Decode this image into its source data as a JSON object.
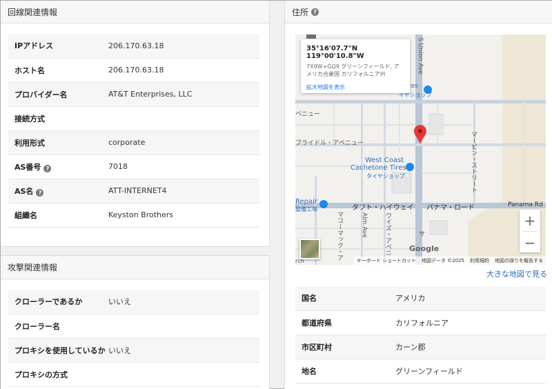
{
  "left_panel": {
    "title": "回線関連情報",
    "rows": [
      {
        "key": "IPアドレス",
        "value": "206.170.63.18",
        "help": false
      },
      {
        "key": "ホスト名",
        "value": "206.170.63.18",
        "help": false
      },
      {
        "key": "プロバイダー名",
        "value": "AT&T Enterprises, LLC",
        "help": false
      },
      {
        "key": "接続方式",
        "value": "",
        "help": false
      },
      {
        "key": "利用形式",
        "value": "corporate",
        "help": false
      },
      {
        "key": "AS番号",
        "value": "7018",
        "help": true
      },
      {
        "key": "AS名",
        "value": "ATT-INTERNET4",
        "help": true
      },
      {
        "key": "組織名",
        "value": "Keyston Brothers",
        "help": false
      }
    ]
  },
  "attack_panel": {
    "title": "攻撃関連情報",
    "rows": [
      {
        "key": "クローラーであるか",
        "value": "いいえ"
      },
      {
        "key": "クローラー名",
        "value": ""
      },
      {
        "key": "プロキシを使用しているか",
        "value": "いいえ"
      },
      {
        "key": "プロキシの方式",
        "value": ""
      }
    ]
  },
  "address_panel": {
    "title": "住所",
    "big_map_link": "大きな地図で見る",
    "map": {
      "card_coord": "35°16'07.7\"N 119°00'10.8\"W",
      "card_plus_code": "7X9W+GQ9 グリーンフィールド, アメリカ合衆国 カリフォルニア州",
      "card_link": "拡大地図を表示",
      "labels": {
        "union_ave": "S Union Ave",
        "avenue1": "ベニュー",
        "bridle_ave": "ブライドル・アベニュー",
        "west_coast": "West Coast",
        "cachetone": "Cachetone Tires",
        "tire_shop": "タイヤショップ",
        "marvin": "マービン・ストリート",
        "repair": "Repair",
        "repair_jp": "整備工場",
        "taft": "タフト・ハイウェイ",
        "panama_jp": "パナマ・ロード",
        "panama_rd": "Panama Rd",
        "macomac": "マコーマック・ア",
        "alm_ave": "Alm Ave",
        "wise_ave": "ワイズ・アベニ",
        "sa": "サ",
        "ices": "ices",
        "shop_top": "イヤショップ",
        "rch": "rch"
      },
      "google_logo": "Google",
      "attribution": [
        "キーボード ショートカット",
        "地図データ ©2025",
        "利用規約",
        "地図の誤りを報告する"
      ],
      "zoom_in": "+",
      "zoom_out": "−",
      "pin_color": "#e53935"
    },
    "rows": [
      {
        "key": "国名",
        "value": "アメリカ"
      },
      {
        "key": "都道府県",
        "value": "カリフォルニア"
      },
      {
        "key": "市区町村",
        "value": "カーン郡"
      },
      {
        "key": "地名",
        "value": "グリーンフィールド"
      }
    ]
  }
}
